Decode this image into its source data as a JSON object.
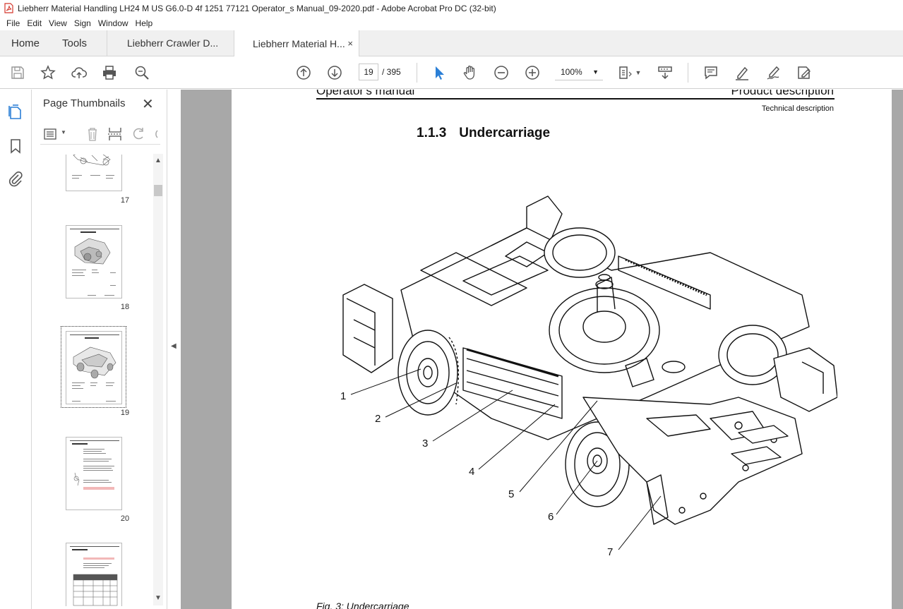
{
  "window": {
    "title": "Liebherr Material Handling LH24 M US G6.0-D 4f 1251 77121 Operator_s Manual_09-2020.pdf - Adobe Acrobat Pro DC (32-bit)"
  },
  "menu": [
    "File",
    "Edit",
    "View",
    "Sign",
    "Window",
    "Help"
  ],
  "tabs": {
    "home": "Home",
    "tools": "Tools",
    "doc1": "Liebherr Crawler D...",
    "doc2": "Liebherr Material H...",
    "close": "×"
  },
  "toolbar": {
    "current_page": "19",
    "page_total": "/ 395",
    "zoom": "100%"
  },
  "panel": {
    "title": "Page Thumbnails",
    "close": "✕",
    "thumbnails": [
      {
        "label": "17"
      },
      {
        "label": "18"
      },
      {
        "label": "19",
        "selected": true
      },
      {
        "label": "20"
      }
    ]
  },
  "document": {
    "header_left": "Operator's manual",
    "header_right": "Product description",
    "header_sub": "Technical description",
    "section_number": "1.1.3",
    "section_title": "Undercarriage",
    "callouts": [
      "1",
      "2",
      "3",
      "4",
      "5",
      "6",
      "7"
    ],
    "caption": "Fig. 3: Undercarriage"
  },
  "icons": {
    "accent": "#2b7fd6",
    "pdf_red": "#d4372c"
  }
}
